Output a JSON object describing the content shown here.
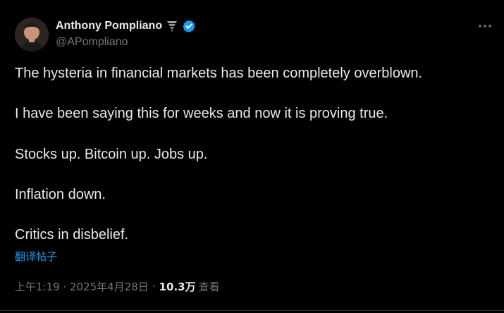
{
  "author": {
    "name": "Anthony Pompliano",
    "handle": "@APompliano",
    "emoji": "tornado-icon",
    "verified": true,
    "verified_color": "#1d9bf0"
  },
  "tweet": {
    "lines": [
      "The hysteria in financial markets has been completely overblown.",
      "I have been saying this for weeks and now it is proving true.",
      "Stocks up. Bitcoin up. Jobs up.",
      "Inflation down.",
      "Critics in disbelief."
    ],
    "translate_label": "翻译帖子"
  },
  "meta": {
    "time": "上午1:19 · 2025年4月28日",
    "separator": "·",
    "views_count": "10.3万",
    "views_label": "查看"
  },
  "icons": {
    "more": "more-horizontal-icon"
  },
  "colors": {
    "background": "#000000",
    "text": "#e7e9ea",
    "muted": "#71767b",
    "accent": "#1d9bf0"
  }
}
